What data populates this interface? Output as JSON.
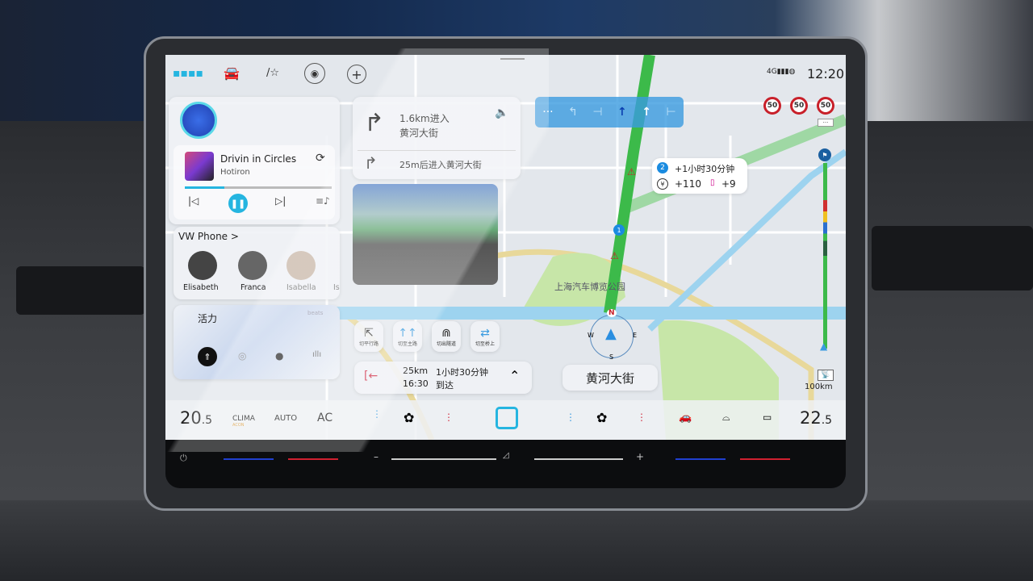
{
  "status": {
    "network": "4G",
    "time": "12:20"
  },
  "topbar": {
    "icons": [
      "apps-grid-icon",
      "car-icon",
      "light-icon",
      "driver-assist-icon",
      "add-icon"
    ]
  },
  "media": {
    "title": "Drivin in Circles",
    "artist": "Hotiron",
    "progress": 0.27
  },
  "phone": {
    "title": "VW Phone",
    "chevron": ">",
    "contacts": [
      "Elisabeth",
      "Franca",
      "Isabella",
      "Is"
    ]
  },
  "vitality": {
    "title": "活力",
    "brand": "beats"
  },
  "nav": {
    "main_distance": "1.6km进入",
    "main_road": "黄河大街",
    "next": "25m后进入黄河大街",
    "route_options": [
      "切平行路",
      "切至主路",
      "切出隧道",
      "切至桥上"
    ],
    "remaining_distance": "25km",
    "remaining_time": "1小时30分钟",
    "arrival_time": "16:30",
    "arrival_label": "到达",
    "current_road": "黄河大街",
    "park_label": "上海汽车博览公园",
    "alt_route": {
      "number": "2",
      "time": "+1小时30分钟",
      "cost": "+110",
      "lights": "+9"
    },
    "speed_limits": [
      "50",
      "50",
      "50"
    ],
    "more": "···",
    "scale": "100km",
    "lanes_more": "···",
    "compass": {
      "n": "N",
      "s": "S",
      "e": "E",
      "w": "W"
    },
    "route_marker": "1"
  },
  "climate": {
    "left_temp": "20",
    "left_temp_dec": ".5",
    "clima": "CLIMA",
    "clima_sub": "ACON",
    "auto": "AUTO",
    "ac": "AC",
    "right_temp": "22",
    "right_temp_dec": ".5"
  },
  "bezel": {
    "minus": "–",
    "plus": "+"
  },
  "colors": {
    "accent": "#25b5e0",
    "route": "#3cba4a",
    "lane_bar": "#3a9be0",
    "speed_ring": "#c8202a"
  }
}
